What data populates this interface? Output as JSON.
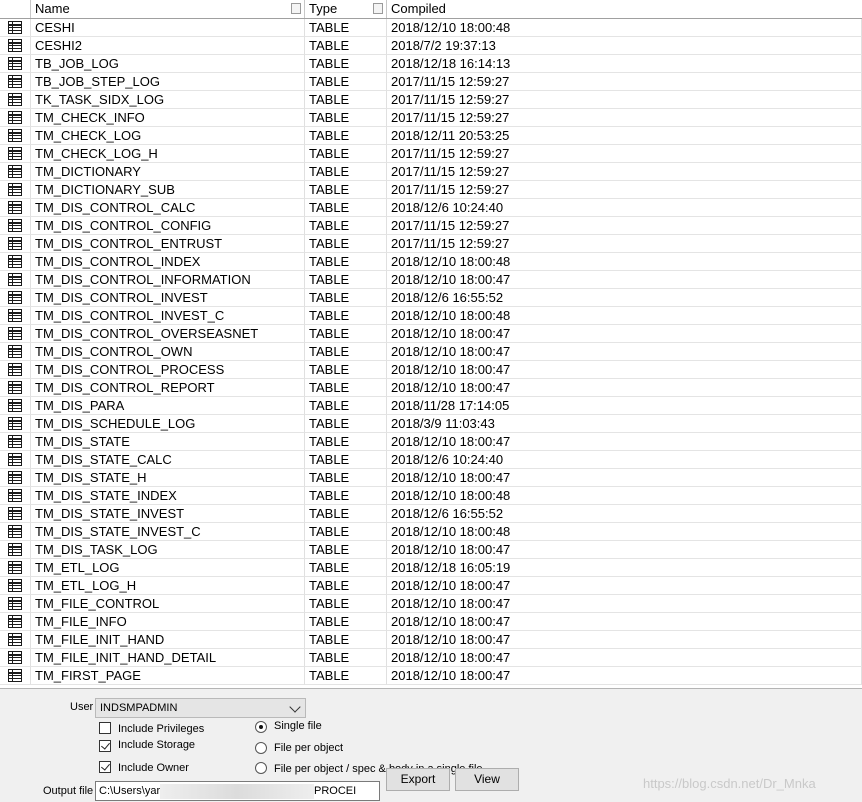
{
  "table": {
    "columns": [
      "Name",
      "Type",
      "Compiled"
    ],
    "rows": [
      {
        "name": "CESHI",
        "type": "TABLE",
        "compiled": "2018/12/10 18:00:48"
      },
      {
        "name": "CESHI2",
        "type": "TABLE",
        "compiled": "2018/7/2 19:37:13"
      },
      {
        "name": "TB_JOB_LOG",
        "type": "TABLE",
        "compiled": "2018/12/18 16:14:13"
      },
      {
        "name": "TB_JOB_STEP_LOG",
        "type": "TABLE",
        "compiled": "2017/11/15 12:59:27"
      },
      {
        "name": "TK_TASK_SIDX_LOG",
        "type": "TABLE",
        "compiled": "2017/11/15 12:59:27"
      },
      {
        "name": "TM_CHECK_INFO",
        "type": "TABLE",
        "compiled": "2017/11/15 12:59:27"
      },
      {
        "name": "TM_CHECK_LOG",
        "type": "TABLE",
        "compiled": "2018/12/11 20:53:25"
      },
      {
        "name": "TM_CHECK_LOG_H",
        "type": "TABLE",
        "compiled": "2017/11/15 12:59:27"
      },
      {
        "name": "TM_DICTIONARY",
        "type": "TABLE",
        "compiled": "2017/11/15 12:59:27"
      },
      {
        "name": "TM_DICTIONARY_SUB",
        "type": "TABLE",
        "compiled": "2017/11/15 12:59:27"
      },
      {
        "name": "TM_DIS_CONTROL_CALC",
        "type": "TABLE",
        "compiled": "2018/12/6 10:24:40"
      },
      {
        "name": "TM_DIS_CONTROL_CONFIG",
        "type": "TABLE",
        "compiled": "2017/11/15 12:59:27"
      },
      {
        "name": "TM_DIS_CONTROL_ENTRUST",
        "type": "TABLE",
        "compiled": "2017/11/15 12:59:27"
      },
      {
        "name": "TM_DIS_CONTROL_INDEX",
        "type": "TABLE",
        "compiled": "2018/12/10 18:00:48"
      },
      {
        "name": "TM_DIS_CONTROL_INFORMATION",
        "type": "TABLE",
        "compiled": "2018/12/10 18:00:47"
      },
      {
        "name": "TM_DIS_CONTROL_INVEST",
        "type": "TABLE",
        "compiled": "2018/12/6 16:55:52"
      },
      {
        "name": "TM_DIS_CONTROL_INVEST_C",
        "type": "TABLE",
        "compiled": "2018/12/10 18:00:48"
      },
      {
        "name": "TM_DIS_CONTROL_OVERSEASNET",
        "type": "TABLE",
        "compiled": "2018/12/10 18:00:47"
      },
      {
        "name": "TM_DIS_CONTROL_OWN",
        "type": "TABLE",
        "compiled": "2018/12/10 18:00:47"
      },
      {
        "name": "TM_DIS_CONTROL_PROCESS",
        "type": "TABLE",
        "compiled": "2018/12/10 18:00:47"
      },
      {
        "name": "TM_DIS_CONTROL_REPORT",
        "type": "TABLE",
        "compiled": "2018/12/10 18:00:47"
      },
      {
        "name": "TM_DIS_PARA",
        "type": "TABLE",
        "compiled": "2018/11/28 17:14:05"
      },
      {
        "name": "TM_DIS_SCHEDULE_LOG",
        "type": "TABLE",
        "compiled": "2018/3/9 11:03:43"
      },
      {
        "name": "TM_DIS_STATE",
        "type": "TABLE",
        "compiled": "2018/12/10 18:00:47"
      },
      {
        "name": "TM_DIS_STATE_CALC",
        "type": "TABLE",
        "compiled": "2018/12/6 10:24:40"
      },
      {
        "name": "TM_DIS_STATE_H",
        "type": "TABLE",
        "compiled": "2018/12/10 18:00:47"
      },
      {
        "name": "TM_DIS_STATE_INDEX",
        "type": "TABLE",
        "compiled": "2018/12/10 18:00:48"
      },
      {
        "name": "TM_DIS_STATE_INVEST",
        "type": "TABLE",
        "compiled": "2018/12/6 16:55:52"
      },
      {
        "name": "TM_DIS_STATE_INVEST_C",
        "type": "TABLE",
        "compiled": "2018/12/10 18:00:48"
      },
      {
        "name": "TM_DIS_TASK_LOG",
        "type": "TABLE",
        "compiled": "2018/12/10 18:00:47"
      },
      {
        "name": "TM_ETL_LOG",
        "type": "TABLE",
        "compiled": "2018/12/18 16:05:19"
      },
      {
        "name": "TM_ETL_LOG_H",
        "type": "TABLE",
        "compiled": "2018/12/10 18:00:47"
      },
      {
        "name": "TM_FILE_CONTROL",
        "type": "TABLE",
        "compiled": "2018/12/10 18:00:47"
      },
      {
        "name": "TM_FILE_INFO",
        "type": "TABLE",
        "compiled": "2018/12/10 18:00:47"
      },
      {
        "name": "TM_FILE_INIT_HAND",
        "type": "TABLE",
        "compiled": "2018/12/10 18:00:47"
      },
      {
        "name": "TM_FILE_INIT_HAND_DETAIL",
        "type": "TABLE",
        "compiled": "2018/12/10 18:00:47"
      },
      {
        "name": "TM_FIRST_PAGE",
        "type": "TABLE",
        "compiled": "2018/12/10 18:00:47"
      }
    ],
    "row_icon": "table-icon"
  },
  "options": {
    "user_label": "User",
    "user_value": "INDSMPADMIN",
    "include_privileges": {
      "label": "Include Privileges",
      "checked": false
    },
    "include_storage": {
      "label": "Include Storage",
      "checked": true
    },
    "include_owner": {
      "label": "Include Owner",
      "checked": true
    },
    "single_file": {
      "label": "Single file",
      "selected": true
    },
    "file_per_object": {
      "label": "File per object",
      "selected": false
    },
    "file_per_object_spec": {
      "label": "File per object / spec & body in a single file",
      "selected": false
    },
    "output_file_label": "Output file",
    "output_file_value": "C:\\Users\\yar",
    "output_file_tail": "PROCEI",
    "folder_icon": "folder-open-icon",
    "export_label": "Export",
    "view_label": "View"
  },
  "watermark": "https://blog.csdn.net/Dr_Mnka"
}
